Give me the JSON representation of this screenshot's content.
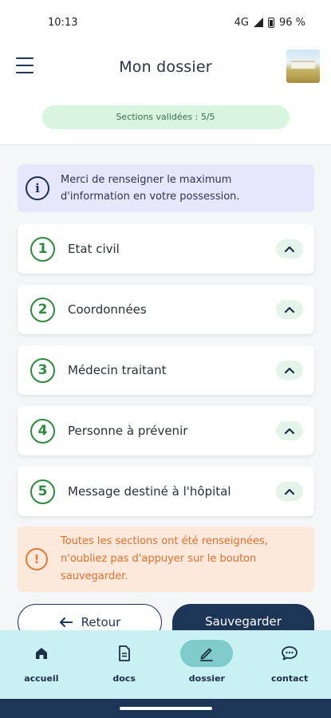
{
  "status_bar": {
    "time": "10:13",
    "network": "4G",
    "battery": "96 %"
  },
  "app_bar": {
    "title": "Mon dossier"
  },
  "progress": {
    "label": "Sections validées : 5/5"
  },
  "info": {
    "text_line1": "Merci de renseigner le maximum",
    "text_line2": "d'information en votre possession."
  },
  "sections": [
    {
      "number": "1",
      "label": "Etat civil"
    },
    {
      "number": "2",
      "label": "Coordonnées"
    },
    {
      "number": "3",
      "label": "Médecin traitant"
    },
    {
      "number": "4",
      "label": "Personne à prévenir"
    },
    {
      "number": "5",
      "label": "Message destiné à l'hôpital"
    }
  ],
  "warning": {
    "line1": "Toutes les sections ont été renseignées,",
    "line2": "n'oubliez pas d'appuyer sur le bouton",
    "line3": "sauvegarder."
  },
  "actions": {
    "back_label": "Retour",
    "save_label": "Sauvegarder"
  },
  "nav": [
    {
      "label": "accueil",
      "icon": "home-icon"
    },
    {
      "label": "docs",
      "icon": "document-icon"
    },
    {
      "label": "dossier",
      "icon": "pen-icon",
      "active": true
    },
    {
      "label": "contact",
      "icon": "chat-bubble-icon"
    }
  ],
  "colors": {
    "primary": "#1d3557",
    "success": "#2e8b3c",
    "warning": "#e27b3a",
    "nav_bg": "#c9f0f2"
  }
}
